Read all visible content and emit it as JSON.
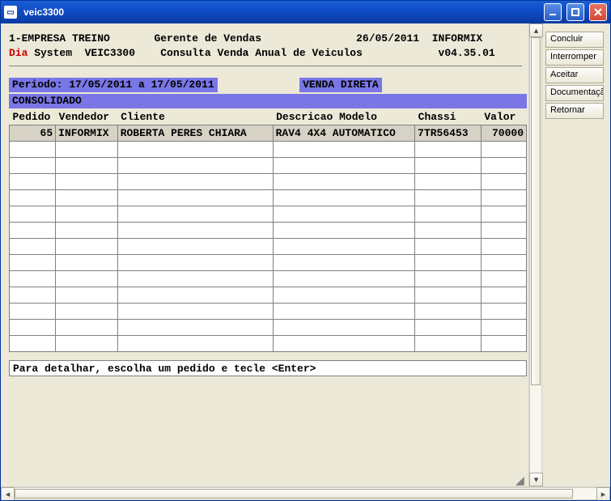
{
  "window": {
    "title": "veic3300"
  },
  "header": {
    "company": "1-EMPRESA TREINO",
    "role": "Gerente de Vendas",
    "date": "26/05/2011",
    "user": "INFORMIX",
    "sys_prefix": "Dia",
    "sys_rest": " System  VEIC3300",
    "subtitle": "Consulta Venda Anual de Veiculos",
    "version": "v04.35.01"
  },
  "filters": {
    "periodo": "Periodo: 17/05/2011 a 17/05/2011",
    "venda": "VENDA DIRETA",
    "consolidado": "CONSOLIDADO"
  },
  "table": {
    "headers": {
      "pedido": "Pedido",
      "vendedor": "Vendedor",
      "cliente": "Cliente",
      "descricao": "Descricao Modelo",
      "chassi": "Chassi",
      "valor": "Valor"
    },
    "rows": [
      {
        "pedido": "65",
        "vendedor": "INFORMIX",
        "cliente": "ROBERTA PERES CHIARA",
        "descricao": "RAV4 4X4 AUTOMATICO",
        "chassi": "7TR56453",
        "valor": "70000"
      }
    ],
    "blank_rows": 13
  },
  "hint": "Para detalhar, escolha um pedido e tecle <Enter>",
  "sidebar": {
    "buttons": [
      "Concluir",
      "Interromper",
      "Aceitar",
      "Documentação",
      "Retornar"
    ]
  }
}
